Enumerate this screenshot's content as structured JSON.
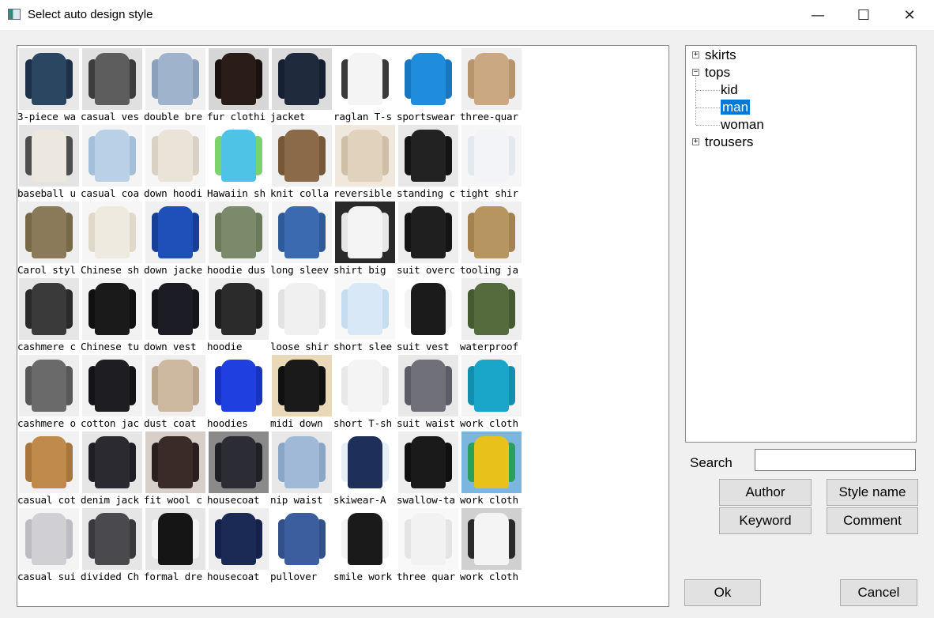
{
  "window": {
    "title": "Select auto design style",
    "minimize": "—",
    "maximize": "☐",
    "close": "✕"
  },
  "gallery": {
    "items": [
      {
        "caption": "3-piece wa",
        "colors": [
          "#2b4660",
          "#1e3148",
          "#e8e8e8"
        ]
      },
      {
        "caption": "casual ves",
        "colors": [
          "#5d5d5d",
          "#3d3d3d",
          "#e0e0e0"
        ]
      },
      {
        "caption": "double bre",
        "colors": [
          "#9fb3cc",
          "#8aa0bb",
          "#f0f0f0"
        ]
      },
      {
        "caption": "fur clothi",
        "colors": [
          "#2a1c17",
          "#1a1210",
          "#d6d6d6"
        ]
      },
      {
        "caption": "jacket",
        "colors": [
          "#1f2a3c",
          "#172033",
          "#dcdcdc"
        ]
      },
      {
        "caption": "raglan T-s",
        "colors": [
          "#f4f4f4",
          "#3a3a3a",
          "#ffffff"
        ]
      },
      {
        "caption": "sportswear",
        "colors": [
          "#1f8ddc",
          "#1877c0",
          "#ffffff"
        ]
      },
      {
        "caption": "three-quar",
        "colors": [
          "#c9a882",
          "#b8946c",
          "#efefef"
        ]
      },
      {
        "caption": "baseball u",
        "colors": [
          "#ece8e0",
          "#4e4e4e",
          "#e4e4e4"
        ]
      },
      {
        "caption": "casual coa",
        "colors": [
          "#b9d0e6",
          "#a3bfd9",
          "#f4f4f4"
        ]
      },
      {
        "caption": "down hoodi",
        "colors": [
          "#e9e3d8",
          "#d9d1c3",
          "#f6f6f6"
        ]
      },
      {
        "caption": "Hawaiin sh",
        "colors": [
          "#4fc3e6",
          "#7ad36b",
          "#ffffff"
        ]
      },
      {
        "caption": "knit colla",
        "colors": [
          "#8a6a49",
          "#765838",
          "#efefef"
        ]
      },
      {
        "caption": "reversible",
        "colors": [
          "#e0d2bd",
          "#cfbfa6",
          "#f0e8dc"
        ]
      },
      {
        "caption": "standing c",
        "colors": [
          "#222222",
          "#151515",
          "#e8e8e8"
        ]
      },
      {
        "caption": "tight shir",
        "colors": [
          "#f2f4f8",
          "#e4e8ef",
          "#f6f6f6"
        ]
      },
      {
        "caption": "Carol styl",
        "colors": [
          "#8b7a5a",
          "#776848",
          "#eeeeee"
        ]
      },
      {
        "caption": "Chinese sh",
        "colors": [
          "#efeadf",
          "#e0d9c9",
          "#f6f6f6"
        ]
      },
      {
        "caption": "down jacke",
        "colors": [
          "#1f4fb8",
          "#173f98",
          "#f0f0f0"
        ]
      },
      {
        "caption": "hoodie dus",
        "colors": [
          "#7a8a6a",
          "#6a7a5a",
          "#f0f0f0"
        ]
      },
      {
        "caption": "long sleev",
        "colors": [
          "#3b6ab0",
          "#2f5a9a",
          "#f4f4f4"
        ]
      },
      {
        "caption": "shirt big",
        "colors": [
          "#f4f4f4",
          "#e6e6e6",
          "#2a2a2a"
        ]
      },
      {
        "caption": "suit overc",
        "colors": [
          "#1f1f1f",
          "#141414",
          "#eeeeee"
        ]
      },
      {
        "caption": "tooling ja",
        "colors": [
          "#b79560",
          "#a3824f",
          "#f0f0f0"
        ]
      },
      {
        "caption": "cashmere c",
        "colors": [
          "#3a3a3a",
          "#2a2a2a",
          "#e6e6e6"
        ]
      },
      {
        "caption": "Chinese tu",
        "colors": [
          "#1a1a1a",
          "#101010",
          "#f2f2f2"
        ]
      },
      {
        "caption": "down vest",
        "colors": [
          "#1c1c24",
          "#14141b",
          "#f6f6f6"
        ]
      },
      {
        "caption": "hoodie",
        "colors": [
          "#2b2b2b",
          "#1d1d1d",
          "#eeeeee"
        ]
      },
      {
        "caption": "loose shir",
        "colors": [
          "#f0f0f0",
          "#e2e2e2",
          "#ffffff"
        ]
      },
      {
        "caption": "short slee",
        "colors": [
          "#d9e8f6",
          "#c6dcf0",
          "#f8f8f8"
        ]
      },
      {
        "caption": "suit vest",
        "colors": [
          "#1b1b1b",
          "#f4f4f4",
          "#ffffff"
        ]
      },
      {
        "caption": "waterproof",
        "colors": [
          "#556b3e",
          "#455a31",
          "#eeeeee"
        ]
      },
      {
        "caption": "cashmere o",
        "colors": [
          "#6a6a6a",
          "#585858",
          "#eeeeee"
        ]
      },
      {
        "caption": "cotton jac",
        "colors": [
          "#1e1e22",
          "#141418",
          "#f2f2f2"
        ]
      },
      {
        "caption": "dust coat",
        "colors": [
          "#cdb9a0",
          "#bba68b",
          "#efefef"
        ]
      },
      {
        "caption": "hoodies",
        "colors": [
          "#1f3fe0",
          "#1733bf",
          "#ffffff"
        ]
      },
      {
        "caption": "midi down",
        "colors": [
          "#1a1a1a",
          "#101010",
          "#e9d9b8"
        ]
      },
      {
        "caption": "short T-sh",
        "colors": [
          "#f4f4f4",
          "#e8e8e8",
          "#ffffff"
        ]
      },
      {
        "caption": "suit waist",
        "colors": [
          "#6f7078",
          "#5c5d64",
          "#e8e8e8"
        ]
      },
      {
        "caption": "work cloth",
        "colors": [
          "#1aa6c8",
          "#138fae",
          "#f4f4f4"
        ]
      },
      {
        "caption": "casual cot",
        "colors": [
          "#c08a4a",
          "#a8763c",
          "#f2f2f2"
        ]
      },
      {
        "caption": "denim jack",
        "colors": [
          "#2a2a30",
          "#1e1e24",
          "#e6e6e6"
        ]
      },
      {
        "caption": "fit wool c",
        "colors": [
          "#3a2a28",
          "#2a1f1d",
          "#d8d0c8"
        ]
      },
      {
        "caption": "housecoat",
        "colors": [
          "#2c2c34",
          "#1f1f26",
          "#8a8a8a"
        ]
      },
      {
        "caption": "nip waist",
        "colors": [
          "#9fb9d6",
          "#8aa6c6",
          "#e8e8e8"
        ]
      },
      {
        "caption": "skiwear-A",
        "colors": [
          "#1e2f5a",
          "#e8eef6",
          "#ffffff"
        ]
      },
      {
        "caption": "swallow-ta",
        "colors": [
          "#1a1a1a",
          "#101010",
          "#eeeeee"
        ]
      },
      {
        "caption": "work cloth",
        "colors": [
          "#e8c21a",
          "#2aa05a",
          "#7ab6e0"
        ]
      },
      {
        "caption": "casual sui",
        "colors": [
          "#cfcfd4",
          "#bcbcc2",
          "#f4f4f4"
        ]
      },
      {
        "caption": "divided Ch",
        "colors": [
          "#4a4a4e",
          "#3a3a3e",
          "#e6e6e6"
        ]
      },
      {
        "caption": "formal dre",
        "colors": [
          "#151515",
          "#f4f4f4",
          "#e6e6e6"
        ]
      },
      {
        "caption": "housecoat",
        "colors": [
          "#1b2a55",
          "#14214a",
          "#eeeeee"
        ]
      },
      {
        "caption": "pullover",
        "colors": [
          "#3d5e9e",
          "#32508a",
          "#ffffff"
        ]
      },
      {
        "caption": "smile work",
        "colors": [
          "#1a1a1a",
          "#f4f4f4",
          "#ffffff"
        ]
      },
      {
        "caption": "three quar",
        "colors": [
          "#f2f2f2",
          "#e4e4e4",
          "#f8f8f8"
        ]
      },
      {
        "caption": "work cloth",
        "colors": [
          "#f4f4f4",
          "#2a2a2a",
          "#d0d0d0"
        ]
      }
    ]
  },
  "tree": {
    "nodes": [
      {
        "label": "skirts",
        "level": 0,
        "expander": "+"
      },
      {
        "label": "tops",
        "level": 0,
        "expander": "−"
      },
      {
        "label": "kid",
        "level": 1
      },
      {
        "label": "man",
        "level": 1,
        "selected": true
      },
      {
        "label": "woman",
        "level": 1
      },
      {
        "label": "trousers",
        "level": 0,
        "expander": "+"
      }
    ]
  },
  "search": {
    "label": "Search",
    "value": "",
    "placeholder": ""
  },
  "buttons": {
    "author": "Author",
    "style_name": "Style name",
    "keyword": "Keyword",
    "comment": "Comment",
    "ok": "Ok",
    "cancel": "Cancel"
  },
  "colors": {
    "selection": "#0078d7"
  }
}
